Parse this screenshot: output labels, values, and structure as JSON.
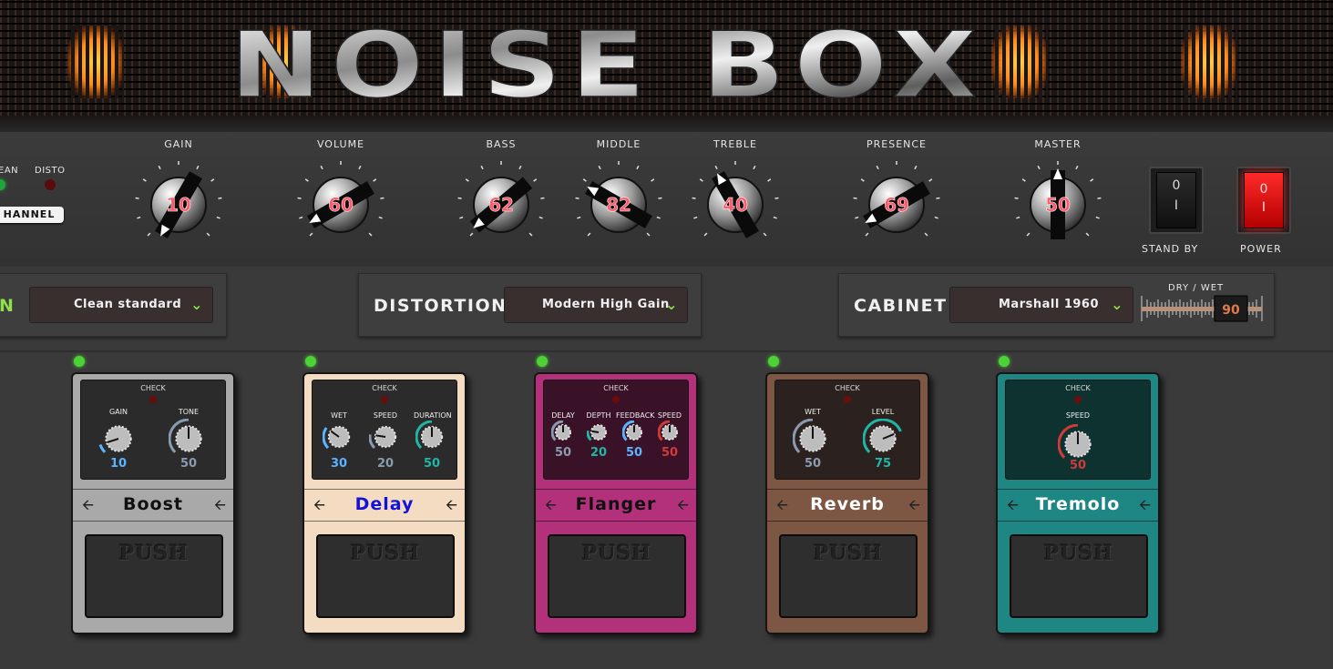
{
  "brand": {
    "logo_text": "NOISE BOX"
  },
  "channel": {
    "clean_label": "EAN",
    "disto_label": "DISTO",
    "button_label": "HANNEL",
    "colors": {
      "clean_led": "#1fa63a",
      "disto_led": "#5a0b0b"
    }
  },
  "amp_knobs": [
    {
      "label": "GAIN",
      "value": "10"
    },
    {
      "label": "VOLUME",
      "value": "60"
    },
    {
      "label": "BASS",
      "value": "62"
    },
    {
      "label": "MIDDLE",
      "value": "82"
    },
    {
      "label": "TREBLE",
      "value": "40"
    },
    {
      "label": "PRESENCE",
      "value": "69"
    },
    {
      "label": "MASTER",
      "value": "50"
    }
  ],
  "switches": {
    "standby": {
      "label": "STAND BY",
      "top": "0",
      "bottom": "I"
    },
    "power": {
      "label": "POWER",
      "top": "0",
      "bottom": "I"
    }
  },
  "selectors": {
    "channel_type": {
      "title": "N",
      "value": "Clean standard"
    },
    "distortion": {
      "title": "DISTORTION",
      "value": "Modern High Gain"
    },
    "cabinet": {
      "title": "CABINET",
      "value": "Marshall 1960"
    },
    "drywet": {
      "label": "DRY / WET",
      "value": "90"
    }
  },
  "pedals": [
    {
      "name": "Boost",
      "color": "#a9a9a9",
      "name_color": "#111111",
      "check": "CHECK",
      "push": "PUSH",
      "knobs": [
        {
          "label": "GAIN",
          "value": "10",
          "color": "#5ab4ff"
        },
        {
          "label": "TONE",
          "value": "50",
          "color": "#8a9bb0"
        }
      ]
    },
    {
      "name": "Delay",
      "color": "#f4dcc2",
      "name_color": "#1212d8",
      "check": "CHECK",
      "push": "PUSH",
      "knobs": [
        {
          "label": "WET",
          "value": "30",
          "color": "#5ab4ff"
        },
        {
          "label": "SPEED",
          "value": "20",
          "color": "#8a9bb0"
        },
        {
          "label": "DURATION",
          "value": "50",
          "color": "#1fb6a6"
        }
      ]
    },
    {
      "name": "Flanger",
      "color": "#b3307a",
      "name_color": "#111111",
      "check": "CHECK",
      "push": "PUSH",
      "knobs": [
        {
          "label": "DELAY",
          "value": "50",
          "color": "#8a9bb0"
        },
        {
          "label": "DEPTH",
          "value": "20",
          "color": "#1fb6a6"
        },
        {
          "label": "FEEDBACK",
          "value": "50",
          "color": "#5ab4ff"
        },
        {
          "label": "SPEED",
          "value": "50",
          "color": "#d03a3a"
        }
      ]
    },
    {
      "name": "Reverb",
      "color": "#7d5743",
      "name_color": "#ffffff",
      "check": "CHECK",
      "push": "PUSH",
      "knobs": [
        {
          "label": "WET",
          "value": "50",
          "color": "#8a9bb0"
        },
        {
          "label": "LEVEL",
          "value": "75",
          "color": "#1fb6a6"
        }
      ]
    },
    {
      "name": "Tremolo",
      "color": "#1f8783",
      "name_color": "#ffffff",
      "check": "CHECK",
      "push": "PUSH",
      "knobs": [
        {
          "label": "SPEED",
          "value": "50",
          "color": "#d03a3a"
        }
      ]
    }
  ]
}
